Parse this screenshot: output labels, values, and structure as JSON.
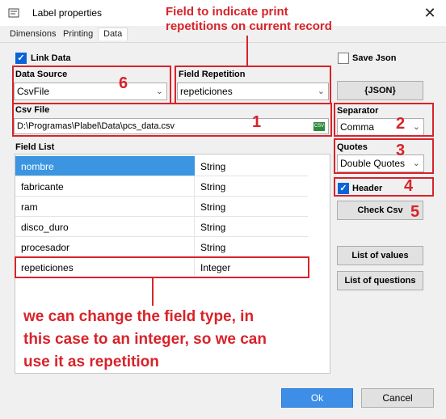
{
  "window": {
    "title": "Label properties",
    "close_glyph": "✕"
  },
  "tabs": [
    {
      "label": "Dimensions",
      "active": false
    },
    {
      "label": "Printing",
      "active": false
    },
    {
      "label": "Data",
      "active": true
    }
  ],
  "link_data": {
    "label": "Link Data",
    "checked": true
  },
  "save_json": {
    "label": "Save Json",
    "checked": false
  },
  "json_button": {
    "label": "{JSON}"
  },
  "data_source": {
    "label": "Data Source",
    "value": "CsvFile"
  },
  "field_repetition": {
    "label": "Field Repetition",
    "value": "repeticiones"
  },
  "csv_file": {
    "label": "Csv File",
    "value": "D:\\Programas\\Plabel\\Data\\pcs_data.csv",
    "icon_text": "CSV"
  },
  "separator": {
    "label": "Separator",
    "value": "Comma"
  },
  "quotes": {
    "label": "Quotes",
    "value": "Double Quotes"
  },
  "header": {
    "label": "Header",
    "checked": true
  },
  "check_csv_button": {
    "label": "Check Csv"
  },
  "list_values_button": {
    "label": "List of values"
  },
  "list_questions_button": {
    "label": "List of questions"
  },
  "field_list": {
    "label": "Field List",
    "rows": [
      {
        "name": "nombre",
        "type": "String",
        "selected": true
      },
      {
        "name": "fabricante",
        "type": "String",
        "selected": false
      },
      {
        "name": "ram",
        "type": "String",
        "selected": false
      },
      {
        "name": "disco_duro",
        "type": "String",
        "selected": false
      },
      {
        "name": "procesador",
        "type": "String",
        "selected": false
      },
      {
        "name": "repeticiones",
        "type": "Integer",
        "selected": false
      }
    ]
  },
  "ok_button": {
    "label": "Ok"
  },
  "cancel_button": {
    "label": "Cancel"
  },
  "annotations": {
    "top_text_line1": "Field to indicate print",
    "top_text_line2": "repetitions on current record",
    "bottom_text_line1": "we can change the field type, in",
    "bottom_text_line2": "this case to an integer, so we can",
    "bottom_text_line3": "use it as repetition",
    "numbers": [
      "1",
      "2",
      "3",
      "4",
      "5",
      "6"
    ],
    "color": "#d8232a"
  },
  "colors": {
    "selection": "#3b95e0",
    "ok_button": "#3c8ee6",
    "checkbox_on": "#0a64d8"
  },
  "icons": [
    "label-properties-icon",
    "close-icon",
    "chevron-down-icon",
    "csv-file-icon",
    "checkmark-icon"
  ]
}
